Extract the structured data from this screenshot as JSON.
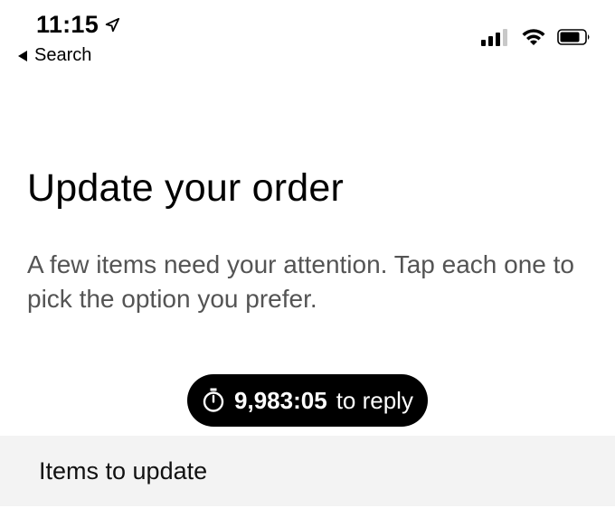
{
  "status_bar": {
    "time": "11:15",
    "location_icon": "location-arrow-icon",
    "back_label": "Search",
    "signal_icon": "cellular-signal-icon",
    "wifi_icon": "wifi-icon",
    "battery_icon": "battery-icon"
  },
  "page": {
    "title": "Update your order",
    "subtitle": "A few items need your attention. Tap each one to pick the option you prefer."
  },
  "timer": {
    "icon": "stopwatch-icon",
    "count": "9,983:05",
    "suffix": "to reply"
  },
  "section": {
    "header": "Items to update"
  },
  "colors": {
    "pill_background": "#000000",
    "section_background": "#f3f3f3",
    "subtitle_text": "#545454"
  }
}
